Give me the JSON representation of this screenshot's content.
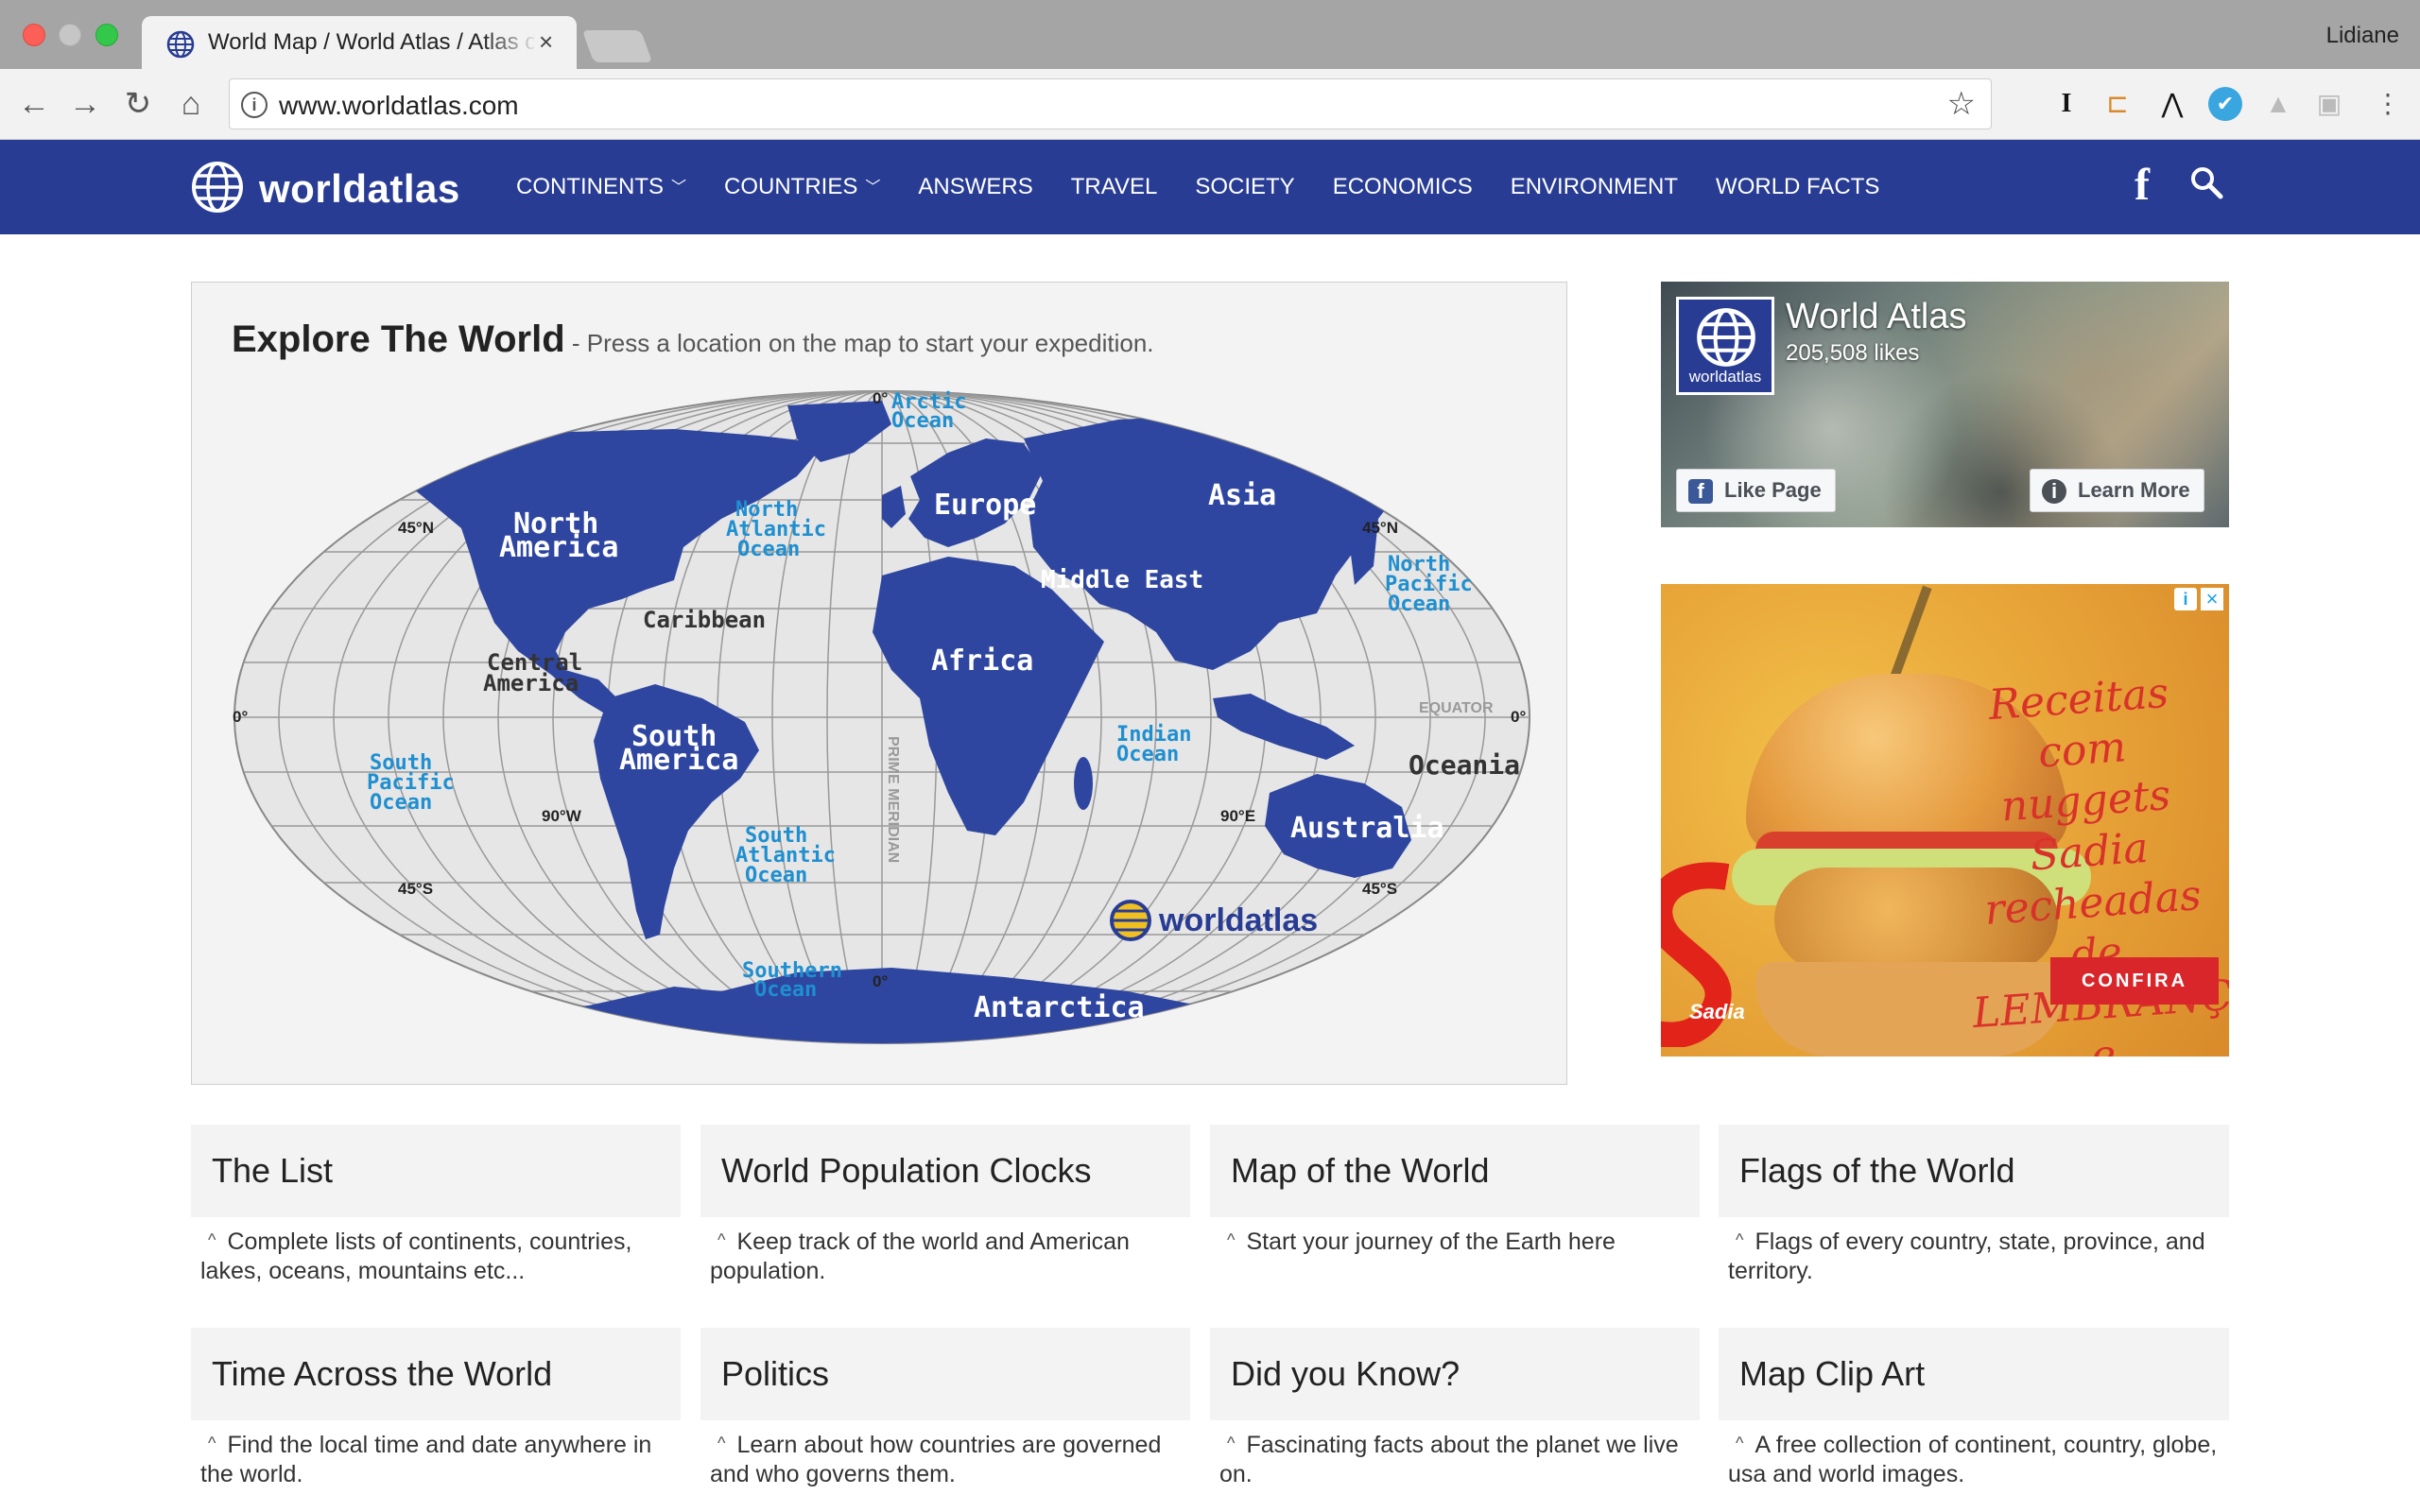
{
  "browser": {
    "tab_title": "World Map / World Atlas / Atlas of the World",
    "url": "www.worldatlas.com",
    "profile_name": "Lidiane"
  },
  "site": {
    "logo_text": "worldatlas",
    "nav": [
      {
        "label": "CONTINENTS",
        "dropdown": true
      },
      {
        "label": "COUNTRIES",
        "dropdown": true
      },
      {
        "label": "ANSWERS",
        "dropdown": false
      },
      {
        "label": "TRAVEL",
        "dropdown": false
      },
      {
        "label": "SOCIETY",
        "dropdown": false
      },
      {
        "label": "ECONOMICS",
        "dropdown": false
      },
      {
        "label": "ENVIRONMENT",
        "dropdown": false
      },
      {
        "label": "WORLD FACTS",
        "dropdown": false
      }
    ],
    "brand_color": "#283c94"
  },
  "map": {
    "heading": "Explore The World",
    "subheading": " - Press a location on the map to start your expedition.",
    "labels": {
      "north_america": [
        "North",
        "America"
      ],
      "south_america": [
        "South",
        "America"
      ],
      "central_america": [
        "Central",
        "America"
      ],
      "caribbean": "Caribbean",
      "europe": "Europe",
      "asia": "Asia",
      "middle_east": "Middle East",
      "africa": "Africa",
      "australia": "Australia",
      "oceania": "Oceania",
      "antarctica": "Antarctica",
      "arctic_ocean": [
        "Arctic",
        "Ocean"
      ],
      "north_atlantic": [
        "North",
        "Atlantic",
        "Ocean"
      ],
      "south_atlantic": [
        "South",
        "Atlantic",
        "Ocean"
      ],
      "north_pacific": [
        "North",
        "Pacific",
        "Ocean"
      ],
      "south_pacific": [
        "South",
        "Pacific",
        "Ocean"
      ],
      "indian_ocean": [
        "Indian",
        "Ocean"
      ],
      "southern_ocean": [
        "Southern",
        "Ocean"
      ],
      "equator": "EQUATOR",
      "prime_meridian": "PRIME MERIDIAN",
      "lat_45n_left": "45°N",
      "lat_45n_right": "45°N",
      "lat_45s_left": "45°S",
      "lat_45s_right": "45°S",
      "zero_left": "0°",
      "zero_right": "0°",
      "zero_top": "0°",
      "zero_bottom": "0°",
      "lon_90w": "90°W",
      "lon_90e": "90°E",
      "watermark": "worldatlas"
    }
  },
  "facebook": {
    "page_name": "World Atlas",
    "likes": "205,508 likes",
    "logo_label": "worldatlas",
    "like_button": "Like Page",
    "learn_button": "Learn More"
  },
  "ad": {
    "slogan": [
      "Receitas com",
      "nuggets Sadia",
      "recheadas de",
      "LEMBRANÇAS",
      "e SABORES."
    ],
    "cta": "CONFIRA",
    "brand": "Sadia"
  },
  "cards": [
    {
      "title": "The List",
      "desc": "Complete lists of continents, countries, lakes, oceans, mountains etc..."
    },
    {
      "title": "World Population Clocks",
      "desc": "Keep track of the world and American population."
    },
    {
      "title": "Map of the World",
      "desc": "Start your journey of the Earth here"
    },
    {
      "title": "Flags of the World",
      "desc": "Flags of every country, state, province, and territory."
    },
    {
      "title": "Time Across the World",
      "desc": "Find the local time and date anywhere in the world."
    },
    {
      "title": "Politics",
      "desc": "Learn about how countries are governed and who governs them."
    },
    {
      "title": "Did you Know?",
      "desc": "Fascinating facts about the planet we live on."
    },
    {
      "title": "Map Clip Art",
      "desc": "A free collection of continent, country, globe, usa and world images."
    }
  ]
}
